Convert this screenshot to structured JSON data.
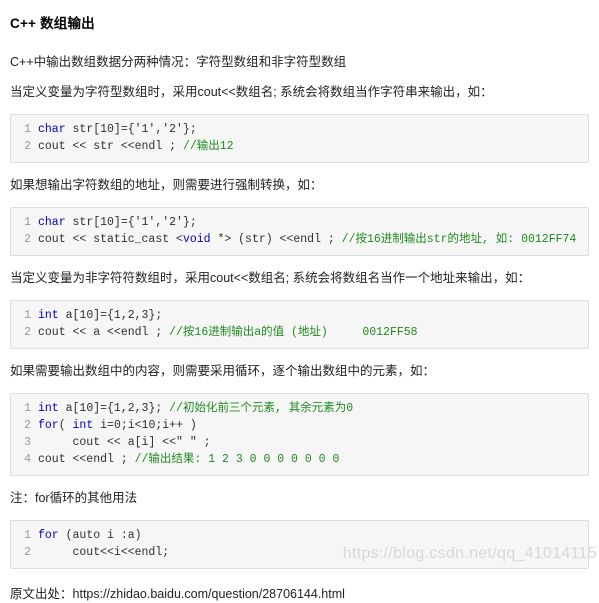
{
  "page": {
    "title": "C++ 数组输出",
    "watermark": "https://blog.csdn.net/qq_41014115"
  },
  "paragraphs": {
    "intro": "C++中输出数组数据分两种情况：字符型数组和非字符型数组",
    "p1": "当定义变量为字符型数组时，采用cout<<数组名; 系统会将数组当作字符串来输出，如：",
    "p2": "如果想输出字符数组的地址，则需要进行强制转换，如：",
    "p3": "当定义变量为非字符符数组时，采用cout<<数组名; 系统会将数组名当作一个地址来输出，如：",
    "p4": "如果需要输出数组中的内容，则需要采用循环，逐个输出数组中的元素，如：",
    "p5": "注：for循环的其他用法"
  },
  "footer": {
    "label": "原文出处：",
    "url": "https://zhidao.baidu.com/question/28706144.html"
  },
  "colors": {
    "keyword": "#0000c0",
    "comment": "#1f8a1f",
    "line_number": "#9a9a9a",
    "code_bg": "#f6f6f6",
    "code_border": "#dddddd",
    "text": "#222222"
  },
  "code_blocks": [
    {
      "id": "block-1",
      "lines": [
        {
          "n": "1",
          "tokens": [
            {
              "t": "char",
              "c": "kw"
            },
            {
              "t": " str[10]={'1','2'};",
              "c": "plain"
            }
          ]
        },
        {
          "n": "2",
          "tokens": [
            {
              "t": "cout << str <<endl ; ",
              "c": "plain"
            },
            {
              "t": "//输出12",
              "c": "cmt"
            }
          ]
        }
      ]
    },
    {
      "id": "block-2",
      "lines": [
        {
          "n": "1",
          "tokens": [
            {
              "t": "char",
              "c": "kw"
            },
            {
              "t": " str[10]={'1','2'};",
              "c": "plain"
            }
          ]
        },
        {
          "n": "2",
          "tokens": [
            {
              "t": "cout << static_cast <",
              "c": "plain"
            },
            {
              "t": "void",
              "c": "kw"
            },
            {
              "t": " *> (str) <<endl ; ",
              "c": "plain"
            },
            {
              "t": "//按16进制输出str的地址, 如: 0012FF74",
              "c": "cmt"
            }
          ]
        }
      ]
    },
    {
      "id": "block-3",
      "lines": [
        {
          "n": "1",
          "tokens": [
            {
              "t": "int",
              "c": "kw"
            },
            {
              "t": " a[10]={1,2,3};",
              "c": "plain"
            }
          ]
        },
        {
          "n": "2",
          "tokens": [
            {
              "t": "cout << a <<endl ; ",
              "c": "plain"
            },
            {
              "t": "//按16进制输出a的值 (地址)     0012FF58",
              "c": "cmt"
            }
          ]
        }
      ]
    },
    {
      "id": "block-4",
      "lines": [
        {
          "n": "1",
          "tokens": [
            {
              "t": "int",
              "c": "kw"
            },
            {
              "t": " a[10]={1,2,3}; ",
              "c": "plain"
            },
            {
              "t": "//初始化前三个元素, 其余元素为0",
              "c": "cmt"
            }
          ]
        },
        {
          "n": "2",
          "tokens": [
            {
              "t": "for",
              "c": "kw"
            },
            {
              "t": "( ",
              "c": "plain"
            },
            {
              "t": "int",
              "c": "kw"
            },
            {
              "t": " i=0;i<10;i++ )",
              "c": "plain"
            }
          ]
        },
        {
          "n": "3",
          "tokens": [
            {
              "t": "     cout << a[i] <<\" \" ;",
              "c": "plain"
            }
          ]
        },
        {
          "n": "4",
          "tokens": [
            {
              "t": "cout <<endl ; ",
              "c": "plain"
            },
            {
              "t": "//输出结果: 1 2 3 0 0 0 0 0 0 0",
              "c": "cmt"
            }
          ]
        }
      ]
    },
    {
      "id": "block-5",
      "lines": [
        {
          "n": "1",
          "tokens": [
            {
              "t": "for",
              "c": "kw"
            },
            {
              "t": " (auto i :a)",
              "c": "plain"
            }
          ]
        },
        {
          "n": "2",
          "tokens": [
            {
              "t": "     cout<<i<<endl;",
              "c": "plain"
            }
          ]
        }
      ]
    }
  ]
}
